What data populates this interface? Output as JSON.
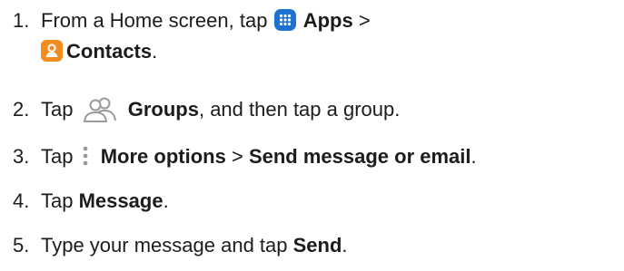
{
  "steps": [
    {
      "number": "1.",
      "text_before": "From a Home screen, tap",
      "icon": "apps-icon",
      "bold1": "Apps",
      "separator": ">",
      "icon2": "contacts-icon",
      "bold2": "Contacts",
      "text_after": "."
    },
    {
      "number": "2.",
      "text_before": "Tap",
      "icon": "groups-icon",
      "bold1": "Groups",
      "text_after": ", and then tap a group."
    },
    {
      "number": "3.",
      "text_before": "Tap",
      "icon": "more-options-icon",
      "bold1": "More options",
      "separator": ">",
      "bold2": "Send message or email",
      "text_after": "."
    },
    {
      "number": "4.",
      "text_before": "Tap",
      "bold1": "Message",
      "text_after": "."
    },
    {
      "number": "5.",
      "text_before": "Type your message and tap",
      "bold1": "Send",
      "text_after": "."
    }
  ],
  "colors": {
    "text": "#1c1c1c",
    "apps_icon": "#1f72cf",
    "contacts_icon": "#f58a1f",
    "groups_icon": "#9a9a9a"
  }
}
